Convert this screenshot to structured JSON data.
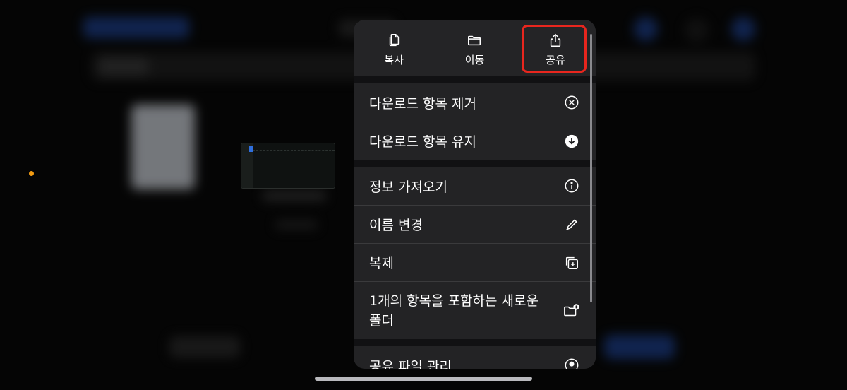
{
  "menu": {
    "top_actions": [
      {
        "label": "복사",
        "icon": "copy-icon"
      },
      {
        "label": "이동",
        "icon": "folder-icon"
      },
      {
        "label": "공유",
        "icon": "share-icon"
      }
    ],
    "group1": [
      {
        "label": "다운로드 항목 제거",
        "icon": "x-circle-icon"
      },
      {
        "label": "다운로드 항목 유지",
        "icon": "download-circle-icon"
      }
    ],
    "group2": [
      {
        "label": "정보 가져오기",
        "icon": "info-icon"
      },
      {
        "label": "이름 변경",
        "icon": "pencil-icon"
      },
      {
        "label": "복제",
        "icon": "duplicate-icon"
      },
      {
        "label": "1개의 항목을 포함하는 새로운 폴더",
        "icon": "folder-plus-icon"
      }
    ],
    "group3": [
      {
        "label": "공유 파일 관리",
        "icon": "person-circle-icon"
      }
    ]
  },
  "colors": {
    "menu_bg": "#1c1c1e",
    "highlight": "#e8261e",
    "accent_dot": "#f39b12"
  }
}
